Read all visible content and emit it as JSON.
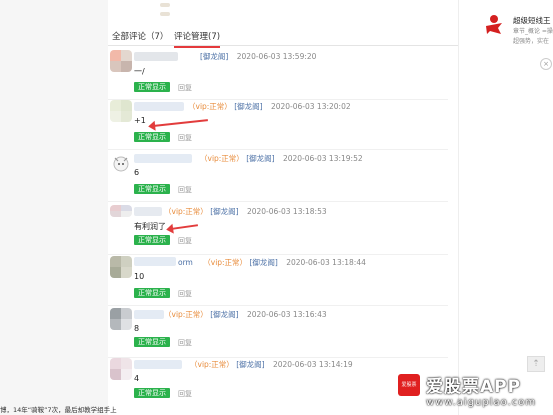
{
  "tabs": [
    {
      "label": "全部评论（7）",
      "active": false
    },
    {
      "label": "评论管理(7)",
      "active": true
    }
  ],
  "comments": [
    {
      "vip": "",
      "section": "[御龙阁]",
      "time": "2020-06-03 13:59:20",
      "content": "一/",
      "status": "正常显示",
      "reply": "回复"
    },
    {
      "vip": "（vip:正常）",
      "section": "[御龙阁]",
      "time": "2020-06-03 13:20:02",
      "content": "+1",
      "status": "正常显示",
      "reply": "回复"
    },
    {
      "vip": "（vip:正常）",
      "section": "[御龙阁]",
      "time": "2020-06-03 13:19:52",
      "content": "6",
      "status": "正常显示",
      "reply": "回复"
    },
    {
      "vip": "（vip:正常）",
      "section": "[御龙阁]",
      "time": "2020-06-03 13:18:53",
      "content": "有利润了",
      "status": "正常显示",
      "reply": "回复"
    },
    {
      "name_suffix": "orm",
      "vip": "（vip:正常）",
      "section": "[御龙阁]",
      "time": "2020-06-03 13:18:44",
      "content": "10",
      "status": "正常显示",
      "reply": "回复"
    },
    {
      "vip": "（vip:正常）",
      "section": "[御龙阁]",
      "time": "2020-06-03 13:16:43",
      "content": "8",
      "status": "正常显示",
      "reply": "回复"
    },
    {
      "vip": "（vip:正常）",
      "section": "[御龙阁]",
      "time": "2020-06-03 13:14:19",
      "content": "4",
      "status": "正常显示",
      "reply": "回复"
    }
  ],
  "promo": {
    "title": "超级短线王",
    "line1": "章节_概论 =操",
    "line2": "超强势，实在"
  },
  "watermark": {
    "logo_text": "爱股票",
    "title": "爱股票APP",
    "url": "www.aiguplao.com"
  },
  "ticker": "博，14年“骑鞍”7次，最后却教学组手上",
  "colors": {
    "accent": "#e4393c",
    "badge": "#2bb24c",
    "vip": "#e88b3a",
    "section": "#4a6fa5",
    "arrow": "#e23c3c"
  }
}
